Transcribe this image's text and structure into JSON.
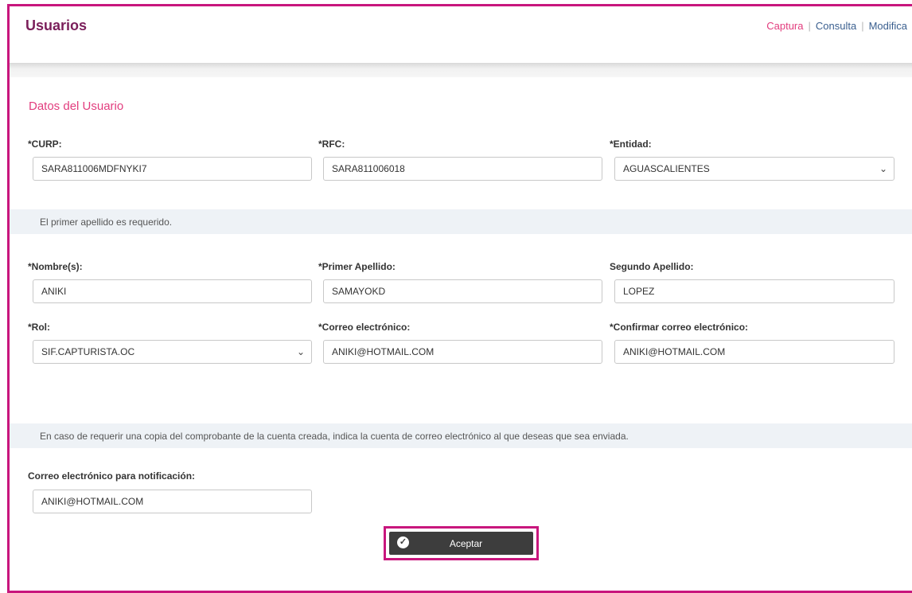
{
  "header": {
    "title": "Usuarios",
    "nav": [
      {
        "label": "Captura",
        "active": true
      },
      {
        "label": "Consulta",
        "active": false
      },
      {
        "label": "Modifica",
        "active": false
      }
    ],
    "separator": "|"
  },
  "section": {
    "title": "Datos del Usuario"
  },
  "fields": {
    "curp": {
      "label": "*CURP:",
      "value": "SARA811006MDFNYKI7"
    },
    "rfc": {
      "label": "*RFC:",
      "value": "SARA811006018"
    },
    "entidad": {
      "label": "*Entidad:",
      "value": "AGUASCALIENTES"
    },
    "nombre": {
      "label": "*Nombre(s):",
      "value": "ANIKI"
    },
    "primer_apellido": {
      "label": "*Primer Apellido:",
      "value": "SAMAYOKD"
    },
    "segundo_apellido": {
      "label": "Segundo Apellido:",
      "value": "LOPEZ"
    },
    "rol": {
      "label": "*Rol:",
      "value": "SIF.CAPTURISTA.OC"
    },
    "correo": {
      "label": "*Correo electrónico:",
      "value": "ANIKI@HOTMAIL.COM"
    },
    "confirmar_correo": {
      "label": "*Confirmar correo electrónico:",
      "value": "ANIKI@HOTMAIL.COM"
    },
    "correo_notificacion": {
      "label": "Correo electrónico para notificación:",
      "value": "ANIKI@HOTMAIL.COM"
    }
  },
  "messages": {
    "error": "El primer apellido es requerido.",
    "info": "En caso de requerir una copia del comprobante de la cuenta creada, indica la cuenta de correo electrónico al que deseas que sea enviada."
  },
  "actions": {
    "accept_label": "Aceptar"
  },
  "colors": {
    "accent": "#c8167d",
    "title": "#7a1e5a",
    "link": "#3a5f8f",
    "active_link": "#e23d7e",
    "button": "#3d3d3d"
  }
}
